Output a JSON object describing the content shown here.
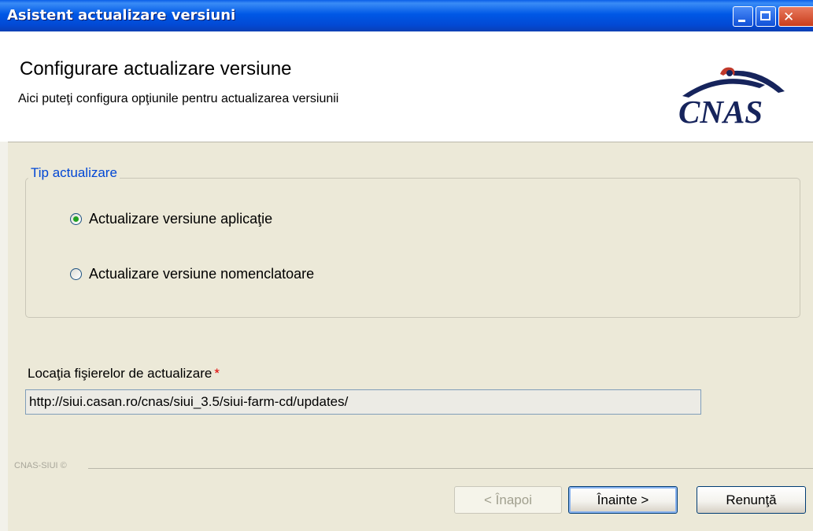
{
  "window": {
    "title": "Asistent actualizare versiuni"
  },
  "header": {
    "title": "Configurare actualizare versiune",
    "subtitle": "Aici puteţi configura opţiunile pentru actualizarea versiunii",
    "logo_text": "CNAS",
    "logo_color": "#16245c"
  },
  "update_type": {
    "group_label": "Tip actualizare",
    "options": [
      {
        "label": "Actualizare versiune aplicaţie",
        "selected": true
      },
      {
        "label": "Actualizare versiune nomenclatoare",
        "selected": false
      }
    ]
  },
  "location": {
    "label": "Locaţia fişierelor de actualizare",
    "required_marker": "*",
    "value": "http://siui.casan.ro/cnas/siui_3.5/siui-farm-cd/updates/"
  },
  "footer": {
    "label": "CNAS-SIUI ©"
  },
  "buttons": {
    "back": "< Înapoi",
    "next": "Înainte >",
    "cancel": "Renunţă"
  },
  "colors": {
    "titlebar": "#0058e6",
    "group_label": "#0046d5",
    "required": "#e00000",
    "radio_selected": "#21a121"
  }
}
